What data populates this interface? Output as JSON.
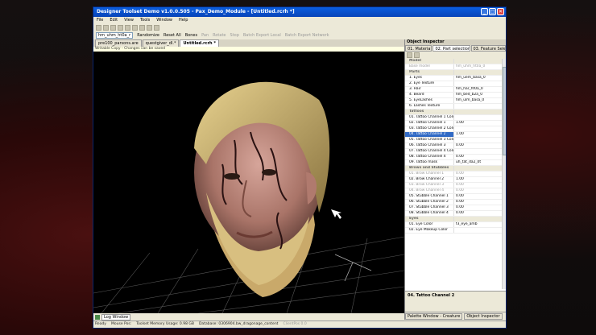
{
  "window": {
    "title": "Designer Toolset Demo v1.0.0.505 - Pax_Demo_Module - [Untitled.rcrh *]",
    "controls": [
      "_",
      "□",
      "✕"
    ]
  },
  "menu": [
    "File",
    "Edit",
    "View",
    "Tools",
    "Window",
    "Help"
  ],
  "toolbar2": {
    "model_select": "hm_uhm_ht0a_r",
    "randomize": "Randomize",
    "reset_all": "Reset All",
    "bones": "Bones",
    "pan": "Pan",
    "rotate": "Rotate",
    "stop": "Stop",
    "batch_export_local": "Batch Export Local",
    "batch_export_network": "Batch Export Network"
  },
  "doc_tabs": [
    {
      "label": "pre100_parsons.are",
      "active": false
    },
    {
      "label": "questgiver_dl.*",
      "active": false
    },
    {
      "label": "Untitled.rcrh *",
      "active": true
    }
  ],
  "viewport_notice": "Writable Copy - Changes can be saved",
  "log_window": "Log Window",
  "inspector": {
    "title": "Object Inspector",
    "tabs": [
      "01. Material",
      "02. Part selection",
      "03. Feature Sele"
    ],
    "rows": [
      {
        "type": "cat",
        "key": "Model",
        "value": ""
      },
      {
        "type": "dim",
        "key": "Base model",
        "value": "hm_uhm_ht0a_0"
      },
      {
        "type": "cat",
        "key": "Parts",
        "value": ""
      },
      {
        "type": "row",
        "key": "1. Eyes",
        "value": "hm_uem_basa_0"
      },
      {
        "type": "row",
        "key": "2. Eye Texture",
        "value": ""
      },
      {
        "type": "row",
        "key": "3. Hair",
        "value": "hm_har_ht0a_0"
      },
      {
        "type": "row",
        "key": "4. Beard",
        "value": "hm_bed_b2a_0"
      },
      {
        "type": "row",
        "key": "5. EyeLashes",
        "value": "hm_ulm_basa_0"
      },
      {
        "type": "row",
        "key": "6. Lashes Texture",
        "value": ""
      },
      {
        "type": "cat",
        "key": "Tattoos",
        "value": ""
      },
      {
        "type": "row",
        "key": "01. Tattoo Channel 1 Color",
        "value": ""
      },
      {
        "type": "row",
        "key": "02. Tattoo Channel 1",
        "value": "1.00"
      },
      {
        "type": "row",
        "key": "03. Tattoo Channel 2 Color",
        "value": ""
      },
      {
        "type": "sel",
        "key": "04. Tattoo Channel 2",
        "value": "1.00"
      },
      {
        "type": "row",
        "key": "05. Tattoo Channel 3 Color",
        "value": ""
      },
      {
        "type": "row",
        "key": "06. Tattoo Channel 3",
        "value": "0.00"
      },
      {
        "type": "row",
        "key": "07. Tattoo Channel 4 Colo",
        "value": ""
      },
      {
        "type": "row",
        "key": "08. Tattoo Channel 4",
        "value": "0.00"
      },
      {
        "type": "row",
        "key": "09. Tattoo mask",
        "value": "uh_tat_da2_0t"
      },
      {
        "type": "cat",
        "key": "Brows and Stubbles",
        "value": ""
      },
      {
        "type": "dim",
        "key": "01. Brow Channel 1",
        "value": "0.00"
      },
      {
        "type": "row",
        "key": "02. Brow Channel 2",
        "value": "1.00"
      },
      {
        "type": "dim",
        "key": "03. Brow Channel 3",
        "value": "0.00"
      },
      {
        "type": "dim",
        "key": "04. Brow Channel 4",
        "value": "0.00"
      },
      {
        "type": "row",
        "key": "05. Stubble Channel 1",
        "value": "0.00"
      },
      {
        "type": "row",
        "key": "06. Stubble Channel 2",
        "value": "0.00"
      },
      {
        "type": "row",
        "key": "07. Stubble Channel 3",
        "value": "0.00"
      },
      {
        "type": "row",
        "key": "08. Stubble Channel 4",
        "value": "0.00"
      },
      {
        "type": "cat",
        "key": "Eyes",
        "value": ""
      },
      {
        "type": "row",
        "key": "01. Eye Color",
        "value": "f3_eye_amb"
      },
      {
        "type": "row",
        "key": "02. Eye Makeup Color",
        "value": ""
      }
    ],
    "description_title": "04. Tattoo Channel 2",
    "bottom_tabs": [
      "Palette Window - Creature",
      "Object Inspector"
    ]
  },
  "statusbar": {
    "ready": "Ready",
    "mouse_pos": "Mouse Pos:",
    "memory": "Toolset Memory Usage: 0.98 GB",
    "database": "Database: 0306904.bw_dragonage_content",
    "tail": "ClientPos 0.0"
  }
}
